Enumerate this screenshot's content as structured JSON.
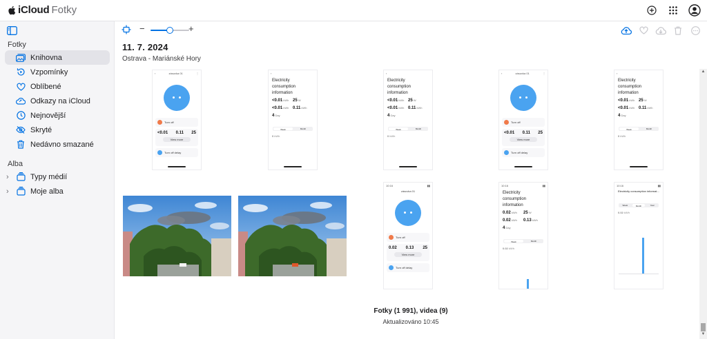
{
  "app": {
    "brand": "iCloud",
    "name": "Fotky"
  },
  "sidebar": {
    "section_library": "Fotky",
    "items": [
      {
        "label": "Knihovna",
        "icon": "library-icon",
        "active": true
      },
      {
        "label": "Vzpomínky",
        "icon": "memories-icon",
        "active": false
      },
      {
        "label": "Oblíbené",
        "icon": "heart-icon",
        "active": false
      },
      {
        "label": "Odkazy na iCloud",
        "icon": "cloud-link-icon",
        "active": false
      },
      {
        "label": "Nejnovější",
        "icon": "clock-icon",
        "active": false
      },
      {
        "label": "Skryté",
        "icon": "eye-slash-icon",
        "active": false
      },
      {
        "label": "Nedávno smazané",
        "icon": "trash-icon",
        "active": false
      }
    ],
    "section_albums": "Alba",
    "albums": [
      {
        "label": "Typy médií",
        "icon": "album-stack-icon"
      },
      {
        "label": "Moje alba",
        "icon": "album-stack-icon"
      }
    ]
  },
  "toolbar": {
    "zoom_minus": "−",
    "zoom_plus": "+",
    "zoom_level": 0.5
  },
  "main": {
    "date": "11. 7. 2024",
    "place": "Ostrava - Mariánské Hory"
  },
  "shots": {
    "status_time": "10:16",
    "device_title": "zásuvka 01",
    "turn_off": "Turn off",
    "view_more": "View more",
    "turn_off_delay": "Turn off delay",
    "consumption_title": "Electricity consumption information",
    "consumption_title_short": "Electricity consumption informat...",
    "stat_a": "<0.01",
    "stat_a_unit": "kWh",
    "stat_b": "25",
    "stat_b_unit": "W",
    "stat_c": "<0.01",
    "stat_d": "0.11",
    "stat_d_unit": "kWh",
    "stat_e": "4",
    "stat_e_unit": "Day",
    "small_zero": "0",
    "small_zero_unit": "kWh",
    "stat_b2": "0.02",
    "stat_c2": "0.02",
    "stat_d2": "0.13",
    "seg_day": "Week",
    "seg_month": "Month",
    "seg_year": "Year"
  },
  "footer": {
    "count": "Fotky (1 991), videa (9)",
    "updated": "Aktualizováno 10:45"
  },
  "colors": {
    "accent": "#0071e3",
    "device_blue": "#4aa3f0",
    "sidebar_bg": "#f5f5f7"
  }
}
